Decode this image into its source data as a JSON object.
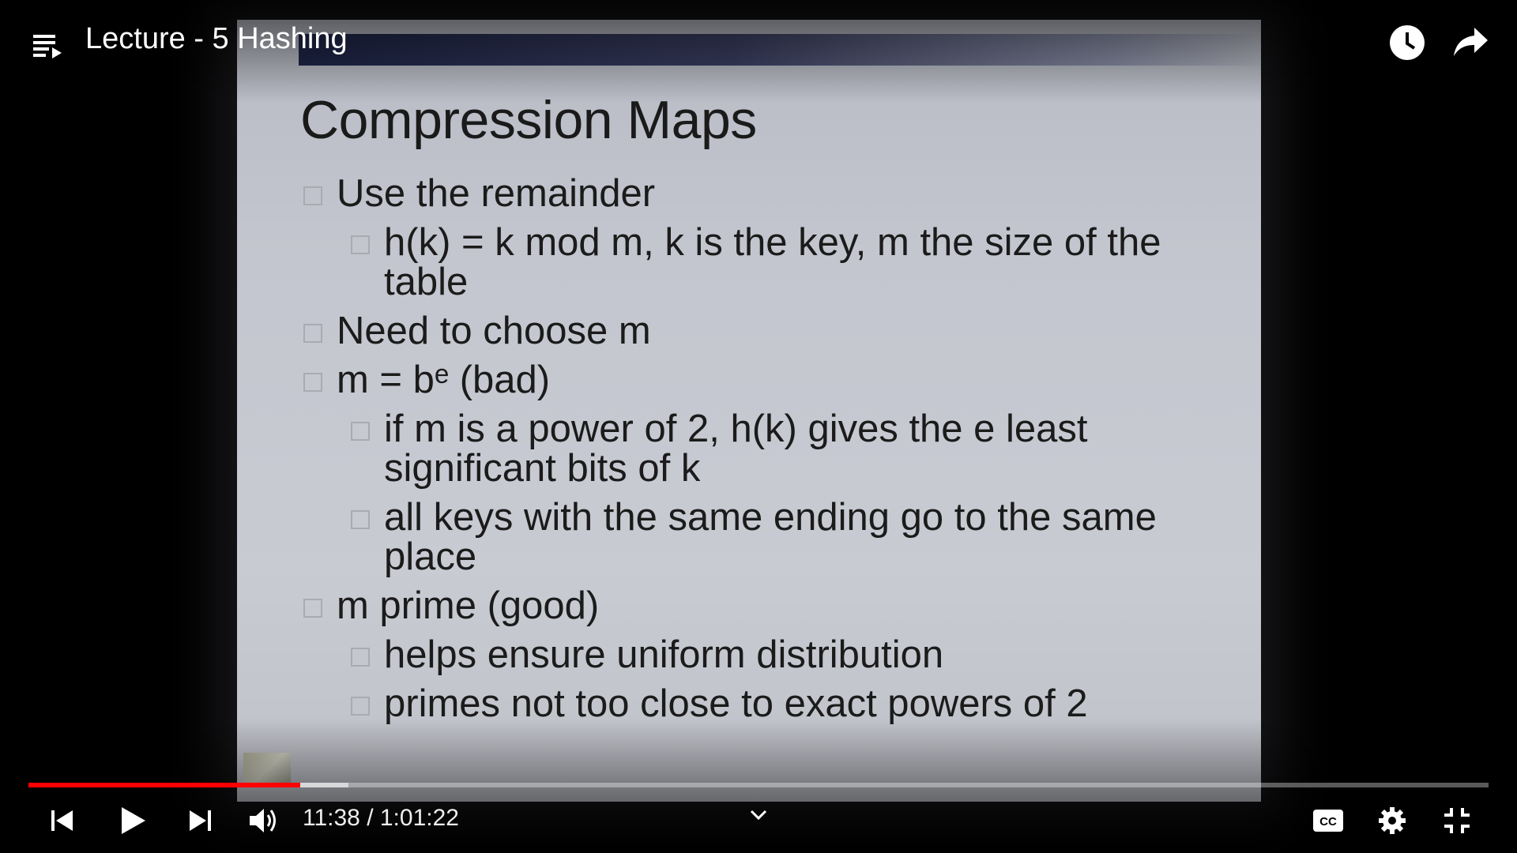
{
  "player": {
    "title": "Lecture - 5 Hashing",
    "current_time": "11:38",
    "separator": " / ",
    "duration": "1:01:22",
    "progress_played_fraction": 0.186,
    "progress_buffered_fraction": 0.219,
    "accent_color": "#ff0000"
  },
  "slide": {
    "title": "Compression Maps",
    "items": [
      {
        "level": 1,
        "text": "Use the remainder"
      },
      {
        "level": 2,
        "text": "h(k) = k mod m, k is the key, m the size of the table"
      },
      {
        "level": 1,
        "text": "Need to choose m"
      },
      {
        "level": 1,
        "text": "m = bᵉ (bad)"
      },
      {
        "level": 2,
        "text": "if m is a power of 2, h(k) gives the e least significant bits of k"
      },
      {
        "level": 2,
        "text": "all keys with the same ending go to the same place"
      },
      {
        "level": 1,
        "text": "m prime (good)"
      },
      {
        "level": 2,
        "text": "helps ensure uniform distribution"
      },
      {
        "level": 2,
        "text": "primes not too close to exact powers of 2"
      }
    ]
  },
  "icons": {
    "playlist": "playlist-icon",
    "watch_later": "clock-icon",
    "share": "share-icon",
    "previous": "skip-previous-icon",
    "play": "play-icon",
    "next": "skip-next-icon",
    "volume": "volume-icon",
    "expand": "chevron-down-icon",
    "captions": "cc-icon",
    "settings": "gear-icon",
    "exit_fullscreen": "exit-fullscreen-icon"
  }
}
